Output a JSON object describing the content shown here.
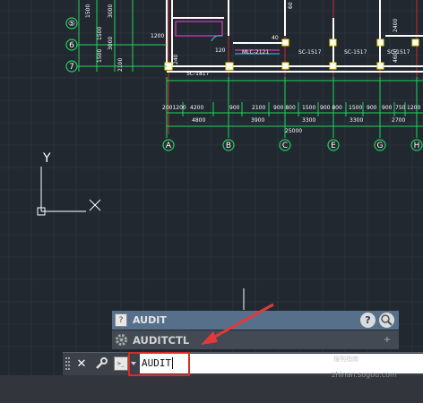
{
  "drawing": {
    "grid_labels_left": [
      "⑤",
      "6",
      "7"
    ],
    "grid_labels_bottom": [
      "A",
      "B",
      "C",
      "E",
      "G",
      "H"
    ],
    "dims_row1": [
      "2001200",
      "4200",
      "900",
      "2100",
      "900 800",
      "1500",
      "900 800",
      "1500",
      "900",
      "900",
      "750",
      "1200"
    ],
    "dims_row2": [
      "4800",
      "3900",
      "3300",
      "3300",
      "2700"
    ],
    "dims_row3": "25000",
    "room_labels": [
      "MLC-2121",
      "SC-1517",
      "SC-1517",
      "SC-1517",
      "SC-1817"
    ],
    "small_dims": [
      "1200",
      "1500",
      "1500",
      "3000",
      "3000",
      "1500",
      "2100",
      "1200",
      "60",
      "120",
      "40",
      "240",
      "2400",
      "4600"
    ],
    "ucs": {
      "y": "Y",
      "x": "X"
    }
  },
  "autocomplete": {
    "items": [
      {
        "label": "AUDIT",
        "icon": "command-icon"
      },
      {
        "label": "AUDITCTL",
        "icon": "gear-icon"
      }
    ],
    "help_icon": "?"
  },
  "command_line": {
    "value": "AUDIT",
    "close_glyph": "✕",
    "customize_glyph": "🔧",
    "prompt_glyph": ">_"
  },
  "watermark": {
    "line1": "搜狗指南",
    "line2": "zhinan.sogou.com"
  },
  "colors": {
    "background": "#212830",
    "grid": "#2b333c",
    "green": "#21d35a",
    "red": "#d92b2b",
    "yellow": "#f2e21a",
    "white": "#ffffff",
    "arrow": "#e23a3a"
  }
}
